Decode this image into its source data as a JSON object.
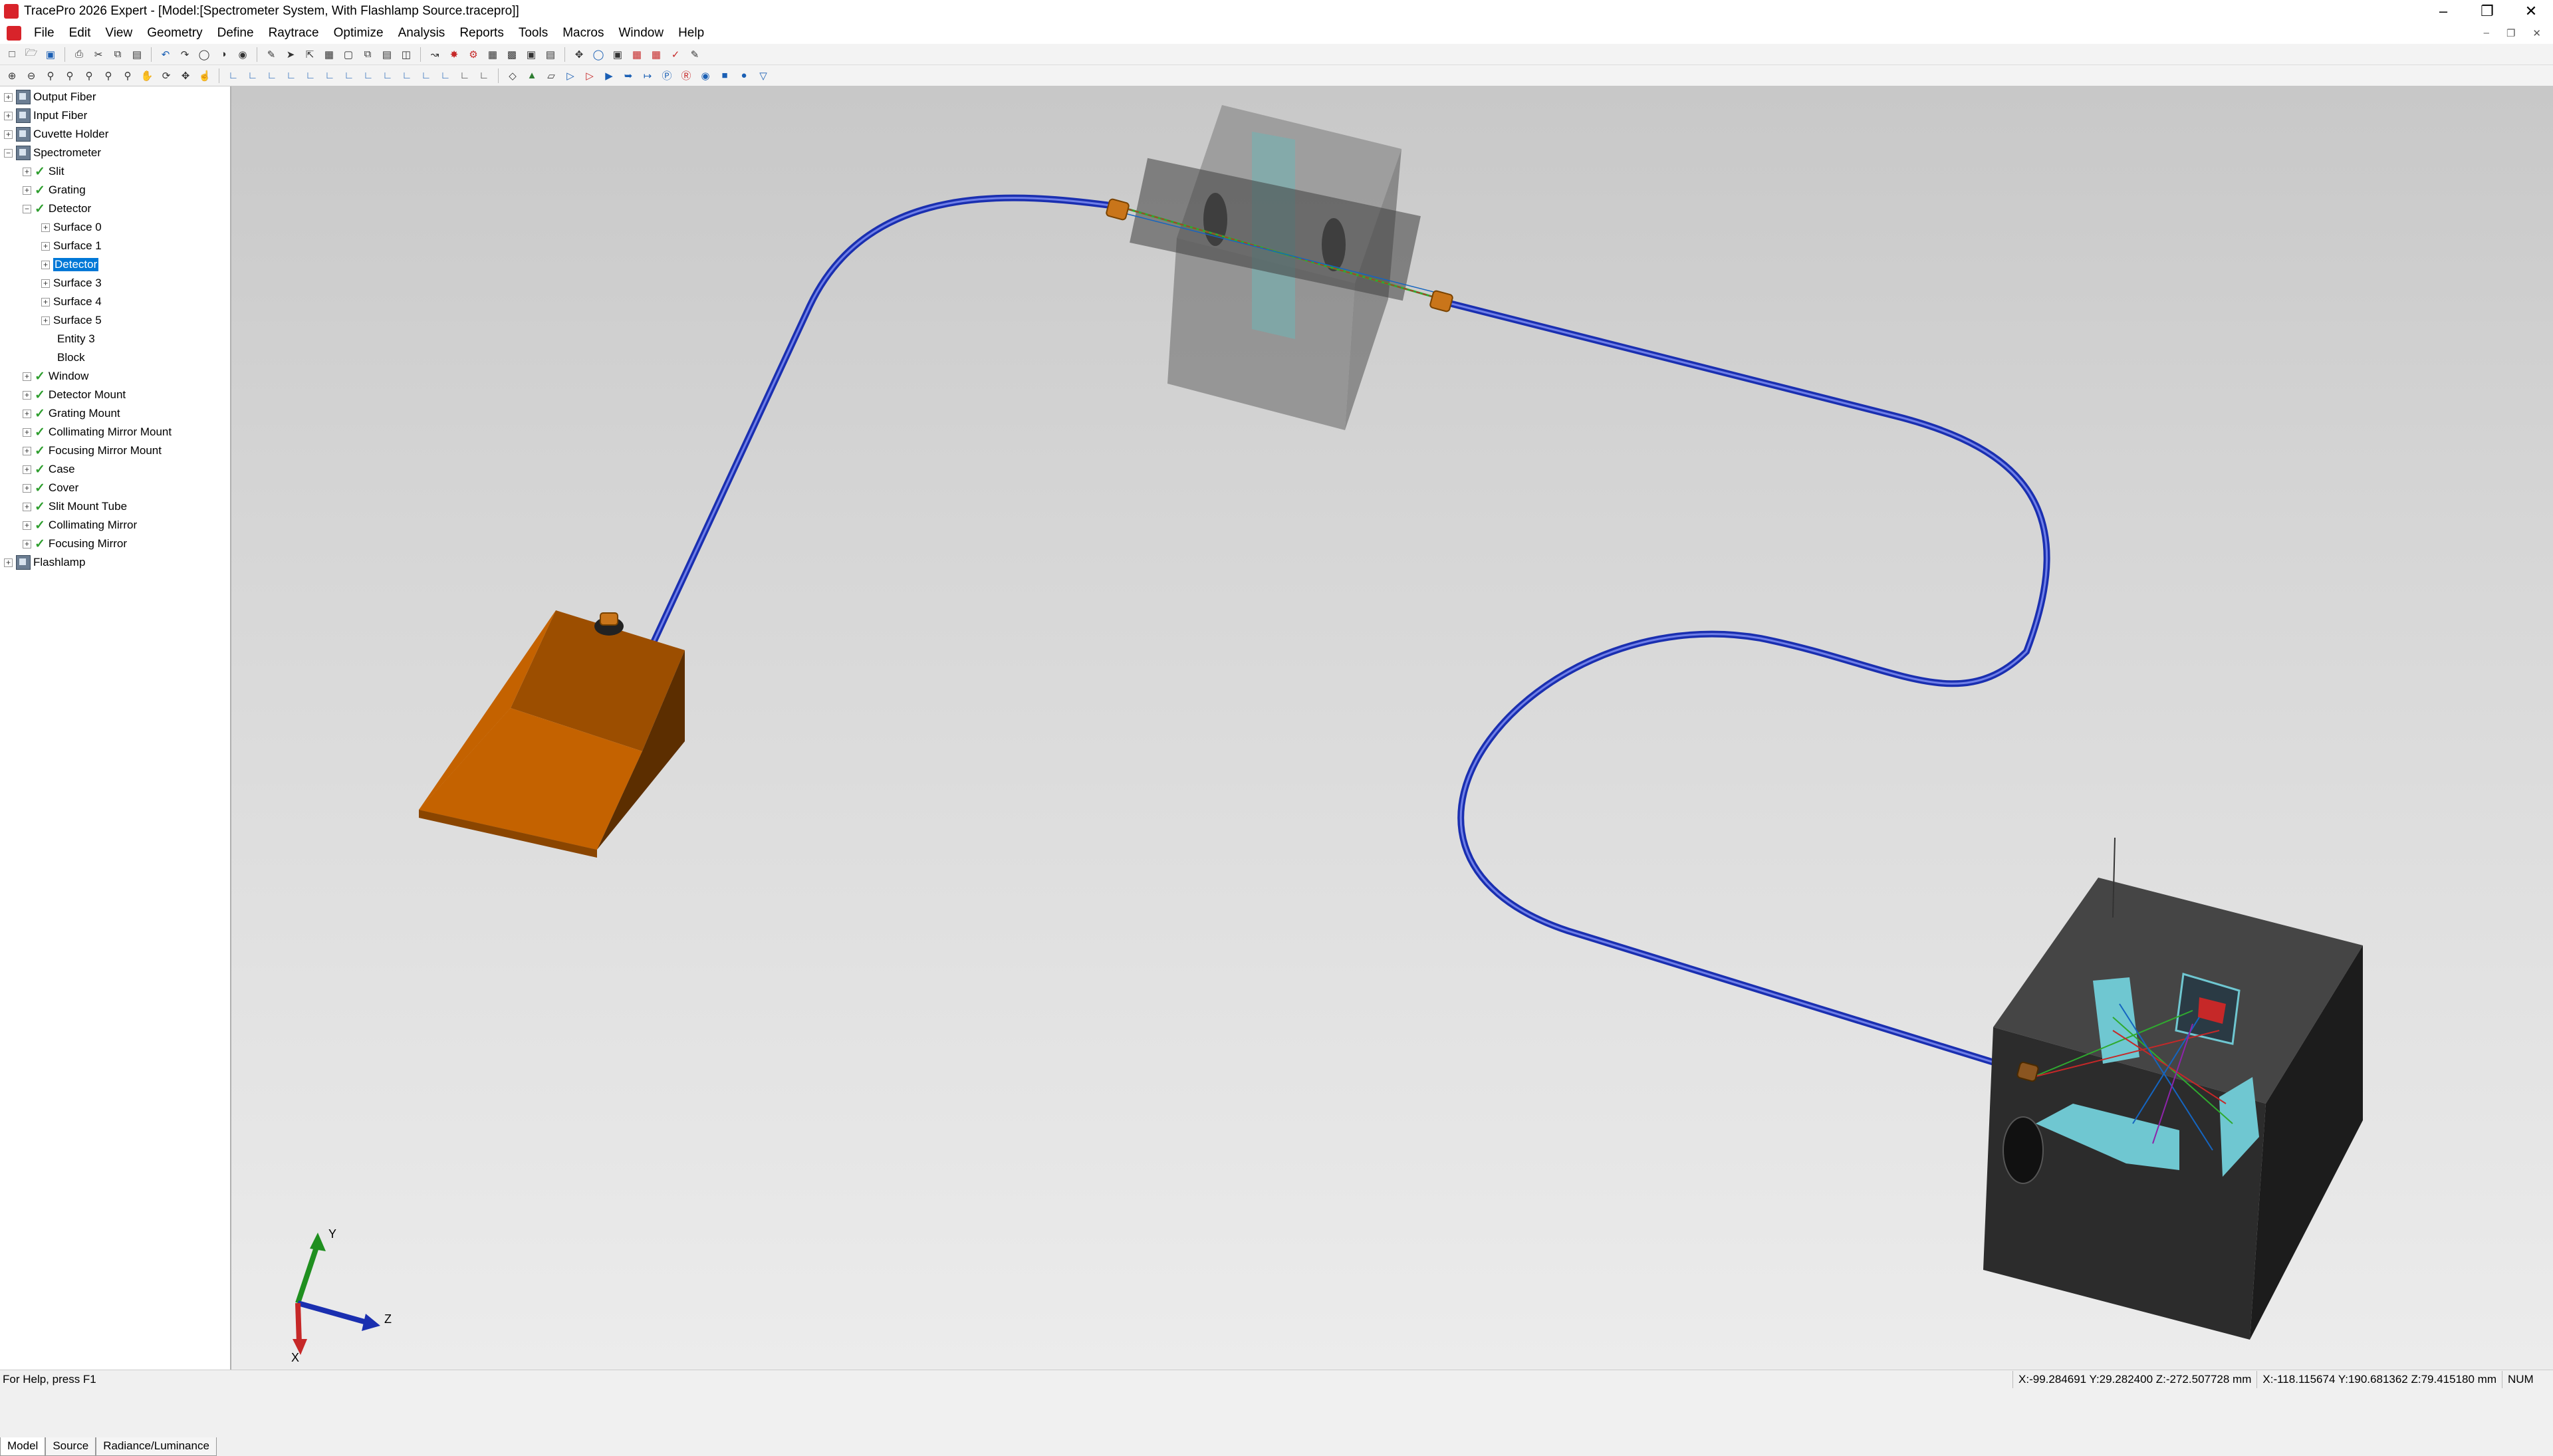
{
  "window": {
    "title": "TracePro 2026 Expert - [Model:[Spectrometer System, With Flashlamp Source.tracepro]]"
  },
  "menu": [
    "File",
    "Edit",
    "View",
    "Geometry",
    "Define",
    "Raytrace",
    "Optimize",
    "Analysis",
    "Reports",
    "Tools",
    "Macros",
    "Window",
    "Help"
  ],
  "tree": {
    "output_fiber": "Output Fiber",
    "input_fiber": "Input Fiber",
    "cuvette_holder": "Cuvette Holder",
    "spectrometer": "Spectrometer",
    "slit": "Slit",
    "grating": "Grating",
    "detector": "Detector",
    "surface0": "Surface 0",
    "surface1": "Surface 1",
    "detector_selected": "Detector",
    "surface4": "Surface 4",
    "surface3": "Surface 3",
    "surface5": "Surface 5",
    "entity3": "Entity 3",
    "block": "Block",
    "window_item": "Window",
    "detector_mount": "Detector Mount",
    "grating_mount": "Grating Mount",
    "collimating_mirror_mount": "Collimating Mirror Mount",
    "focusing_mirror_mount": "Focusing Mirror Mount",
    "case": "Case",
    "cover": "Cover",
    "slit_mount_tube": "Slit Mount Tube",
    "collimating_mirror": "Collimating Mirror",
    "focusing_mirror": "Focusing Mirror",
    "flashlamp": "Flashlamp"
  },
  "tabs": [
    "Model",
    "Source",
    "Radiance/Luminance"
  ],
  "axes": {
    "x": "X",
    "y": "Y",
    "z": "Z"
  },
  "status": {
    "help": "For Help, press F1",
    "coord1": "X:-99.284691 Y:29.282400 Z:-272.507728 mm",
    "coord2": "X:-118.115674 Y:190.681362 Z:79.415180 mm",
    "num": "NUM"
  },
  "colors": {
    "fiber": "#1a2fb0",
    "flashlamp": "#c46200",
    "selection": "#0078d7",
    "check": "#2e9e2e"
  }
}
